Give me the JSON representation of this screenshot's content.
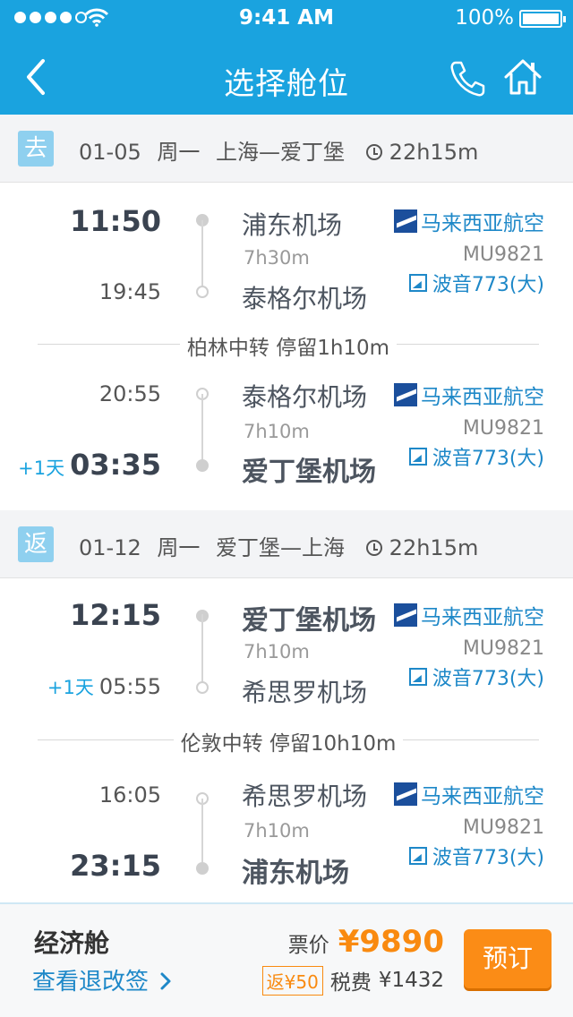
{
  "status_bar": {
    "time": "9:41 AM",
    "battery": "100%"
  },
  "nav": {
    "title": "选择舱位"
  },
  "outbound": {
    "tag": "去",
    "date": "01-05",
    "weekday": "周一",
    "route": "上海—爱丁堡",
    "duration": "22h15m",
    "legs": [
      {
        "dep_time": "11:50",
        "arr_time": "19:45",
        "arr_offset": "",
        "dep_airport": "浦东机场",
        "arr_airport": "泰格尔机场",
        "flight_time": "7h30m",
        "airline": "马来西亚航空",
        "flight_no": "MU9821",
        "aircraft": "波音773(大)"
      },
      {
        "dep_time": "20:55",
        "arr_time": "03:35",
        "arr_offset": "+1天",
        "dep_airport": "泰格尔机场",
        "arr_airport": "爱丁堡机场",
        "flight_time": "7h10m",
        "airline": "马来西亚航空",
        "flight_no": "MU9821",
        "aircraft": "波音773(大)"
      }
    ],
    "transfer": "柏林中转 停留1h10m"
  },
  "return": {
    "tag": "返",
    "date": "01-12",
    "weekday": "周一",
    "route": "爱丁堡—上海",
    "duration": "22h15m",
    "legs": [
      {
        "dep_time": "12:15",
        "arr_time": "05:55",
        "arr_offset": "+1天",
        "dep_airport": "爱丁堡机场",
        "arr_airport": "希思罗机场",
        "flight_time": "7h10m",
        "airline": "马来西亚航空",
        "flight_no": "MU9821",
        "aircraft": "波音773(大)"
      },
      {
        "dep_time": "16:05",
        "arr_time": "23:15",
        "arr_offset": "",
        "dep_airport": "希思罗机场",
        "arr_airport": "浦东机场",
        "flight_time": "7h10m",
        "airline": "马来西亚航空",
        "flight_no": "MU9821",
        "aircraft": "波音773(大)"
      }
    ],
    "transfer": "伦敦中转 停留10h10m"
  },
  "footer": {
    "cabin": "经济舱",
    "rules_link": "查看退改签",
    "price_label": "票价",
    "price": "¥9890",
    "rebate": "返¥50",
    "tax_label": "税费",
    "tax": "¥1432",
    "book_button": "预订"
  },
  "colors": {
    "brand": "#1aa3df",
    "accent": "#fb8c16",
    "link": "#1e88c8"
  }
}
